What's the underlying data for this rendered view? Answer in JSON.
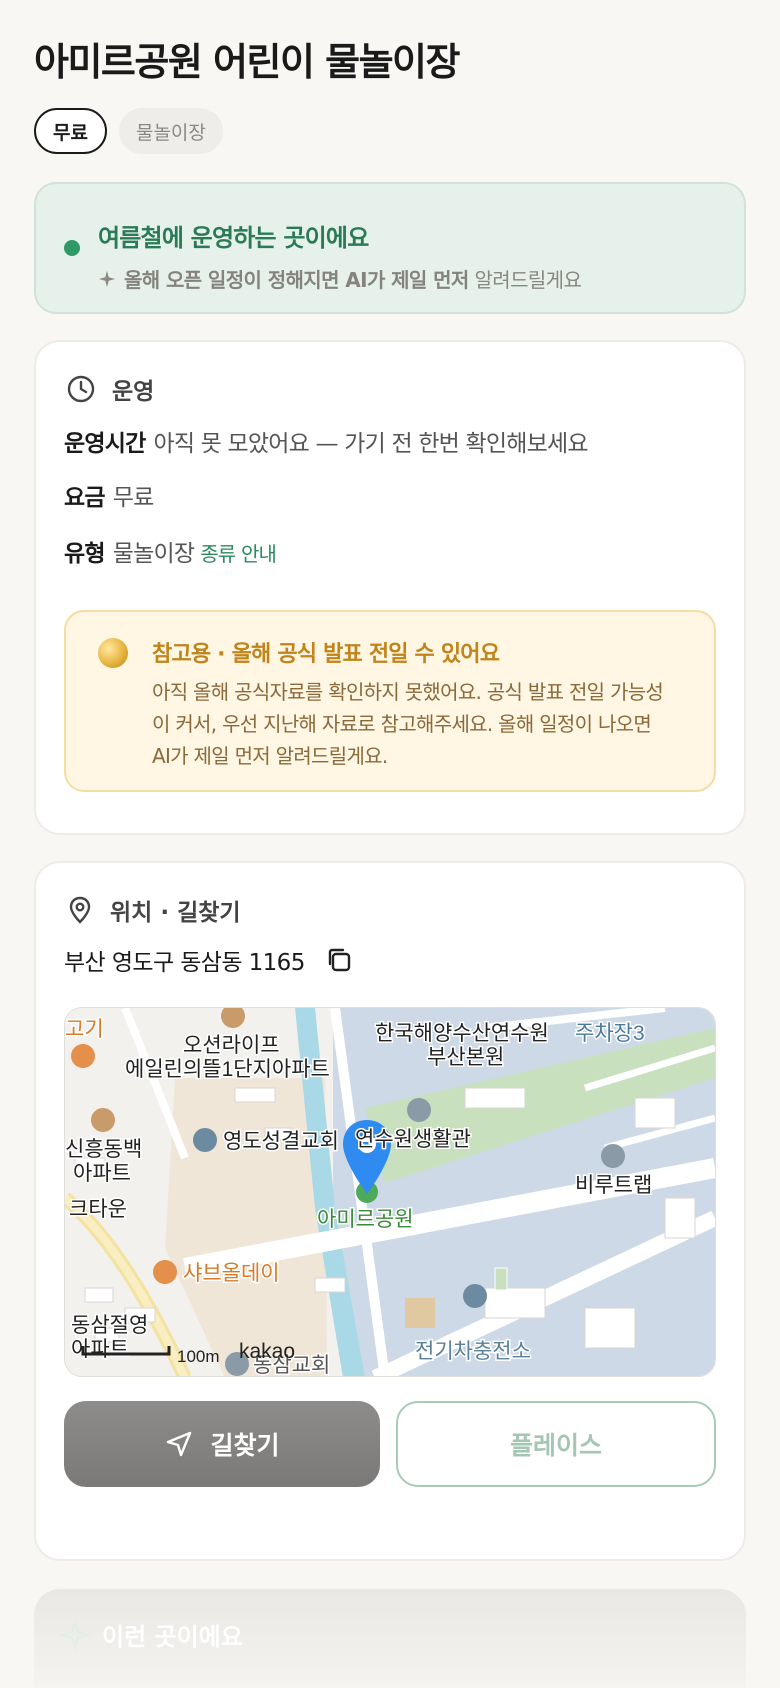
{
  "page": {
    "title": "아미르공원 어린이 물놀이장",
    "tags": [
      {
        "label": "무료",
        "style": "outline"
      },
      {
        "label": "물놀이장",
        "style": "soft"
      }
    ]
  },
  "notice": {
    "headline": "여름철에 운영하는 곳이에요",
    "sub_bold": "올해 오픈 일정이 정해지면 AI가 제일 먼저",
    "sub_rest": "알려드릴게요"
  },
  "operation": {
    "section_title": "운영",
    "rows": [
      {
        "key": "운영시간",
        "value": "아직 못 모았어요 — 가기 전 한번 확인해보세요"
      },
      {
        "key": "요금",
        "value": "무료"
      },
      {
        "key": "유형",
        "value": "물놀이장",
        "link": "종류 안내"
      }
    ],
    "warning": {
      "headline": "참고용 · 올해 공식 발표 전일 수 있어요",
      "body": "아직 올해 공식자료를 확인하지 못했어요. 공식 발표 전일 가능성이 커서, 우선 지난해 자료로 참고해주세요. 올해 일정이 나오면 AI가 제일 먼저 알려드릴게요."
    }
  },
  "location": {
    "section_title": "위치 · 길찾기",
    "address": "부산 영도구 동삼동 1165",
    "map": {
      "labels": {
        "kiost": "한국해양수산연수원",
        "kiost2": "부산본원",
        "parking": "주차장3",
        "oceanlife": "오션라이프",
        "apt1": "에일린의뜰1단지아파트",
        "church1": "영도성결교회",
        "dorm": "연수원생활관",
        "shinheung": "신흥동백",
        "shinheung2": "아파트",
        "park": "아미르공원",
        "bistro": "비루트랩",
        "town": "크타운",
        "shabu": "샤브올데이",
        "dongsam": "동삼절영",
        "dongsam2": "아파트",
        "church2": "동삼교회",
        "ev": "전기차충전소",
        "food_top": "고기",
        "scale": "100m",
        "brand": "kakao"
      }
    },
    "buttons": {
      "directions": "길찾기",
      "place": "플레이스"
    }
  },
  "next_section": {
    "title": "이런 곳이에요"
  },
  "colors": {
    "accent_green": "#2a7a55",
    "warn_orange": "#c0841a",
    "pin_blue": "#2f8bf0"
  }
}
